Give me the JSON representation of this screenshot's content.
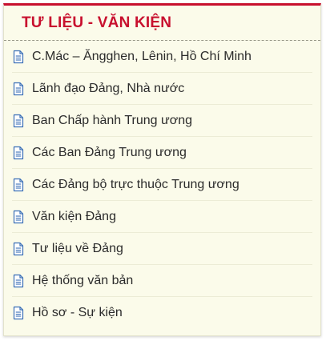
{
  "panel": {
    "title": "TƯ LIỆU - VĂN KIỆN",
    "accent_color": "#c8102e",
    "background_color": "#fbfbea",
    "icon_color": "#3b6fb6"
  },
  "menu": {
    "item_icon": "document-icon",
    "items": [
      {
        "label": "C.Mác – Ăngghen, Lênin, Hồ Chí Minh"
      },
      {
        "label": "Lãnh đạo Đảng, Nhà nước"
      },
      {
        "label": "Ban Chấp hành Trung ương"
      },
      {
        "label": "Các Ban Đảng Trung ương"
      },
      {
        "label": "Các Đảng bộ trực thuộc Trung ương"
      },
      {
        "label": "Văn kiện Đảng"
      },
      {
        "label": "Tư liệu về Đảng"
      },
      {
        "label": "Hệ thống văn bản"
      },
      {
        "label": "Hồ sơ - Sự kiện"
      }
    ]
  }
}
